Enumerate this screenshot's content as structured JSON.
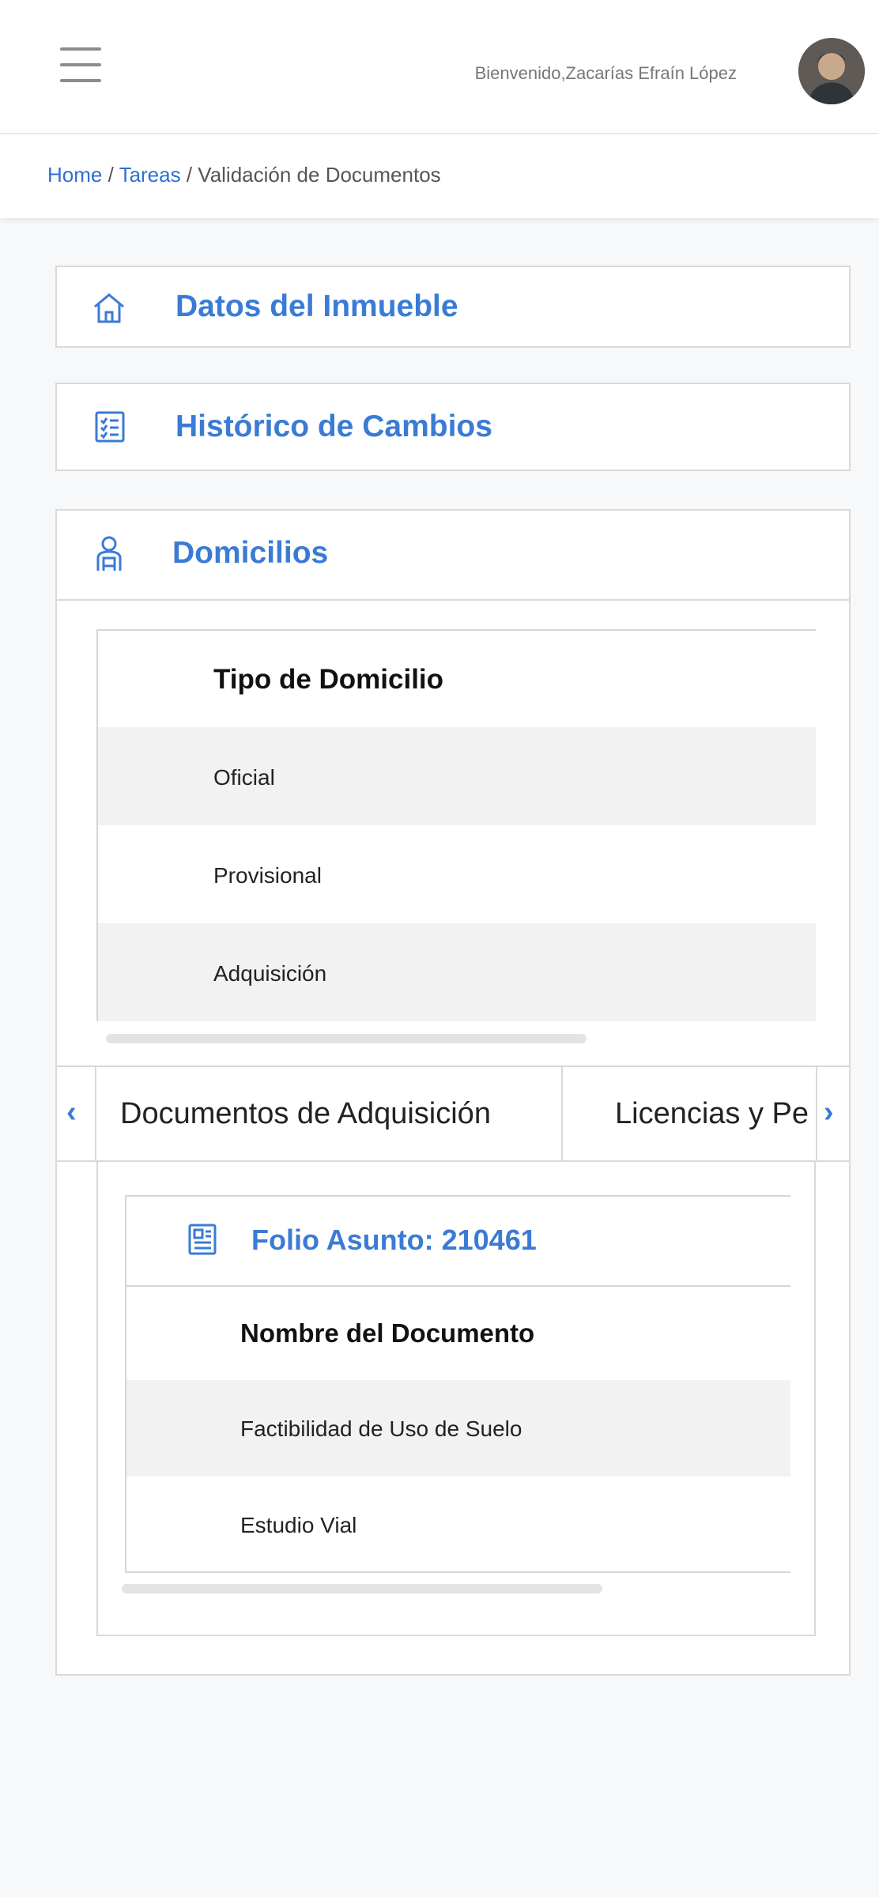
{
  "header": {
    "welcome": "Bienvenido,Zacarías Efraín López"
  },
  "breadcrumb": {
    "home": "Home",
    "separator1": " / ",
    "tasks": "Tareas",
    "separator2": " / ",
    "current": "Validación de Documentos"
  },
  "sections": {
    "property": {
      "title": "Datos del Inmueble",
      "icon": "home-icon"
    },
    "history": {
      "title": "Histórico de Cambios",
      "icon": "checklist-icon"
    },
    "addresses": {
      "title": "Domicilios",
      "icon": "person-icon"
    }
  },
  "address_table": {
    "header": "Tipo de Domicilio",
    "rows": [
      "Oficial",
      "Provisional",
      "Adquisición"
    ]
  },
  "tabs": {
    "items": [
      "Documentos de Adquisición",
      "Licencias y Pe"
    ],
    "prev_icon": "chevron-left-icon",
    "next_icon": "chevron-right-icon"
  },
  "folio": {
    "title": "Folio Asunto: 210461",
    "icon": "document-icon"
  },
  "document_table": {
    "header": "Nombre del Documento",
    "rows": [
      "Factibilidad de Uso de Suelo",
      "Estudio Vial"
    ]
  },
  "colors": {
    "accent": "#3a7bd5",
    "link": "#2f6fd0",
    "row_alt": "#f2f2f2",
    "border": "#d9d9d9"
  }
}
